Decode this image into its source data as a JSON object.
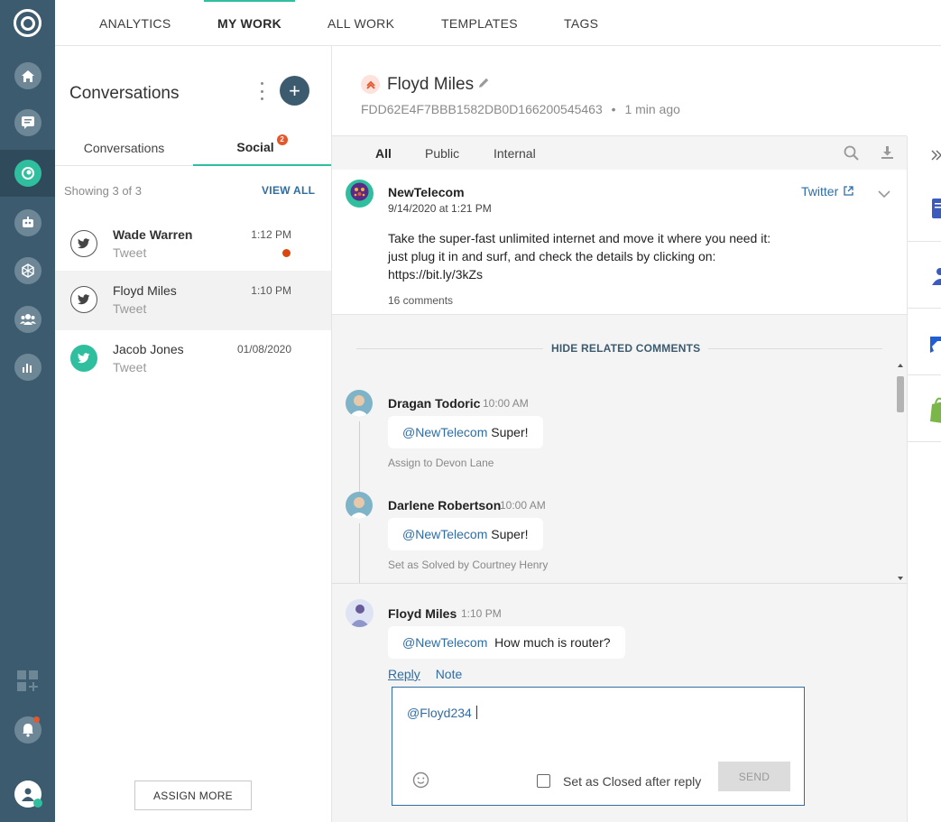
{
  "rail": {
    "items": [
      {
        "name": "home-icon"
      },
      {
        "name": "messages-icon"
      },
      {
        "name": "conversations-icon"
      },
      {
        "name": "bot-icon"
      },
      {
        "name": "network-icon"
      },
      {
        "name": "team-icon"
      },
      {
        "name": "reports-icon"
      }
    ],
    "bottom": [
      "add-widget-icon",
      "notifications-icon",
      "user-avatar-icon"
    ]
  },
  "topnav": {
    "tabs": [
      "ANALYTICS",
      "MY WORK",
      "ALL WORK",
      "TEMPLATES",
      "TAGS"
    ],
    "active": "MY WORK"
  },
  "conversations": {
    "title": "Conversations",
    "subtabs": [
      "Conversations",
      "Social"
    ],
    "social_count": "2",
    "showing": "Showing 3 of 3",
    "view_all": "VIEW ALL",
    "items": [
      {
        "name": "Wade Warren",
        "channel": "Tweet",
        "time": "1:12 PM",
        "unread": true
      },
      {
        "name": "Floyd Miles",
        "channel": "Tweet",
        "time": "1:10 PM",
        "unread": false
      },
      {
        "name": "Jacob Jones",
        "channel": "Tweet",
        "time": "01/08/2020",
        "unread": false
      }
    ],
    "assign_more": "ASSIGN MORE"
  },
  "ticket": {
    "name": "Floyd Miles",
    "id": "FDD62E4F7BBB1582DB0D166200545463",
    "separator": "•",
    "updated": "1 min ago"
  },
  "filters": [
    "All",
    "Public",
    "Internal"
  ],
  "post": {
    "author": "NewTelecom",
    "date": "9/14/2020 at 1:21 PM",
    "source": "Twitter",
    "body": "Take the super-fast unlimited internet and move it where you need it: just plug it in and surf, and check the details by clicking on: https://bit.ly/3kZs",
    "comments": "16 comments"
  },
  "thread": {
    "toggle": "HIDE RELATED COMMENTS",
    "comments": [
      {
        "author": "Dragan Todoric",
        "time": "10:00 AM",
        "mention": "@NewTelecom",
        "text": " Super!",
        "note": "Assign to Devon Lane"
      },
      {
        "author": "Darlene Robertson",
        "time": "10:00 AM",
        "mention": "@NewTelecom",
        "text": " Super!",
        "note": "Set as Solved by Courtney Henry"
      }
    ]
  },
  "latest": {
    "author": "Floyd Miles",
    "time": "1:10 PM",
    "mention": "@NewTelecom",
    "text": "  How much is router?"
  },
  "composer": {
    "tabs": [
      "Reply",
      "Note"
    ],
    "value": "@Floyd234",
    "checkbox_label": "Set as Closed after reply",
    "checked": false,
    "send": "SEND"
  },
  "colors": {
    "rail": "#3d5b6f",
    "accent": "#2fbf9f",
    "link": "#2f6da3",
    "alert": "#e2572c"
  }
}
